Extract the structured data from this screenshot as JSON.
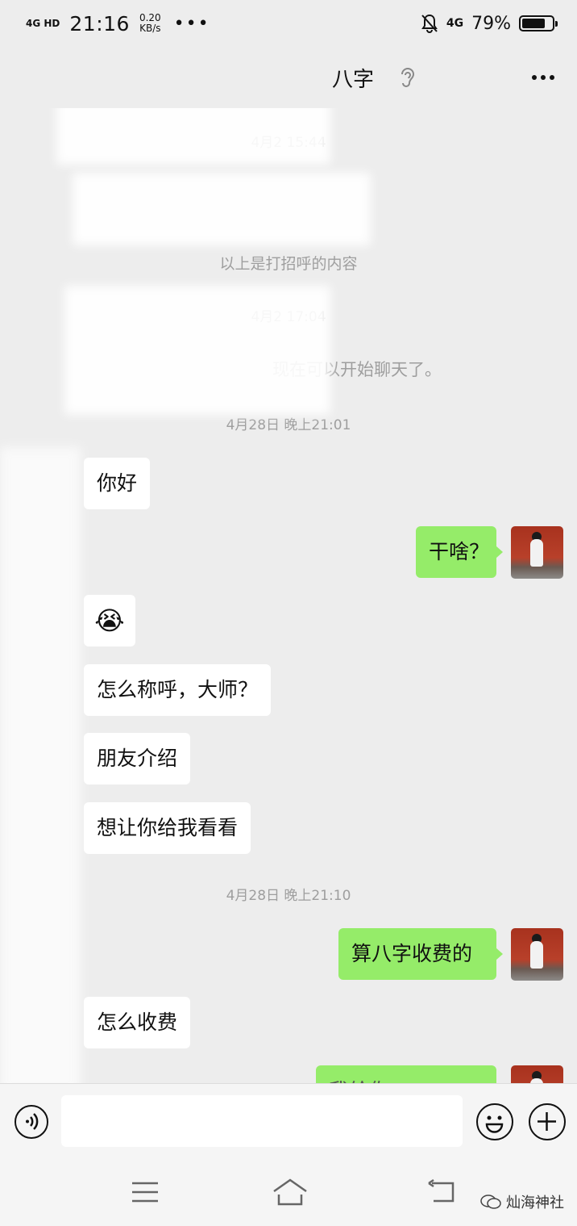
{
  "status_bar": {
    "network": "4G HD",
    "time": "21:16",
    "speed_value": "0.20",
    "speed_unit": "KB/s",
    "dots": "•••",
    "signal_type": "4G",
    "battery": "79%",
    "battery_level": 0.79
  },
  "header": {
    "title": "八字",
    "more_icon": "more-dots-icon",
    "ear_icon": "ear-icon"
  },
  "chat": {
    "timestamp_1": "4月2 15:44",
    "system_1": "以上是打招呼的内容",
    "timestamp_2": "4月2 17:04",
    "system_2": "现在可以开始聊天了。",
    "timestamp_3": "4月28日 晚上21:01",
    "msg_in_1": "你好",
    "msg_out_1": "干啥？",
    "msg_in_emoji": "😭",
    "msg_in_2": "怎么称呼，大师？",
    "msg_in_3": "朋友介绍",
    "msg_in_4": "想让你给我看看",
    "timestamp_4": "4月28日 晚上21:10",
    "msg_out_2": "算八字收费的",
    "msg_in_5": "怎么收费",
    "msg_out_3": "我给你..."
  },
  "input_bar": {
    "voice_icon": "voice-icon",
    "emoji_icon": "emoji-icon",
    "add_icon": "plus-icon"
  },
  "nav": {
    "watermark": "灿海神社"
  },
  "colors": {
    "bg": "#ededed",
    "bubble_out": "#95ec69",
    "bubble_in": "#ffffff",
    "timestamp": "#9e9e9e"
  }
}
